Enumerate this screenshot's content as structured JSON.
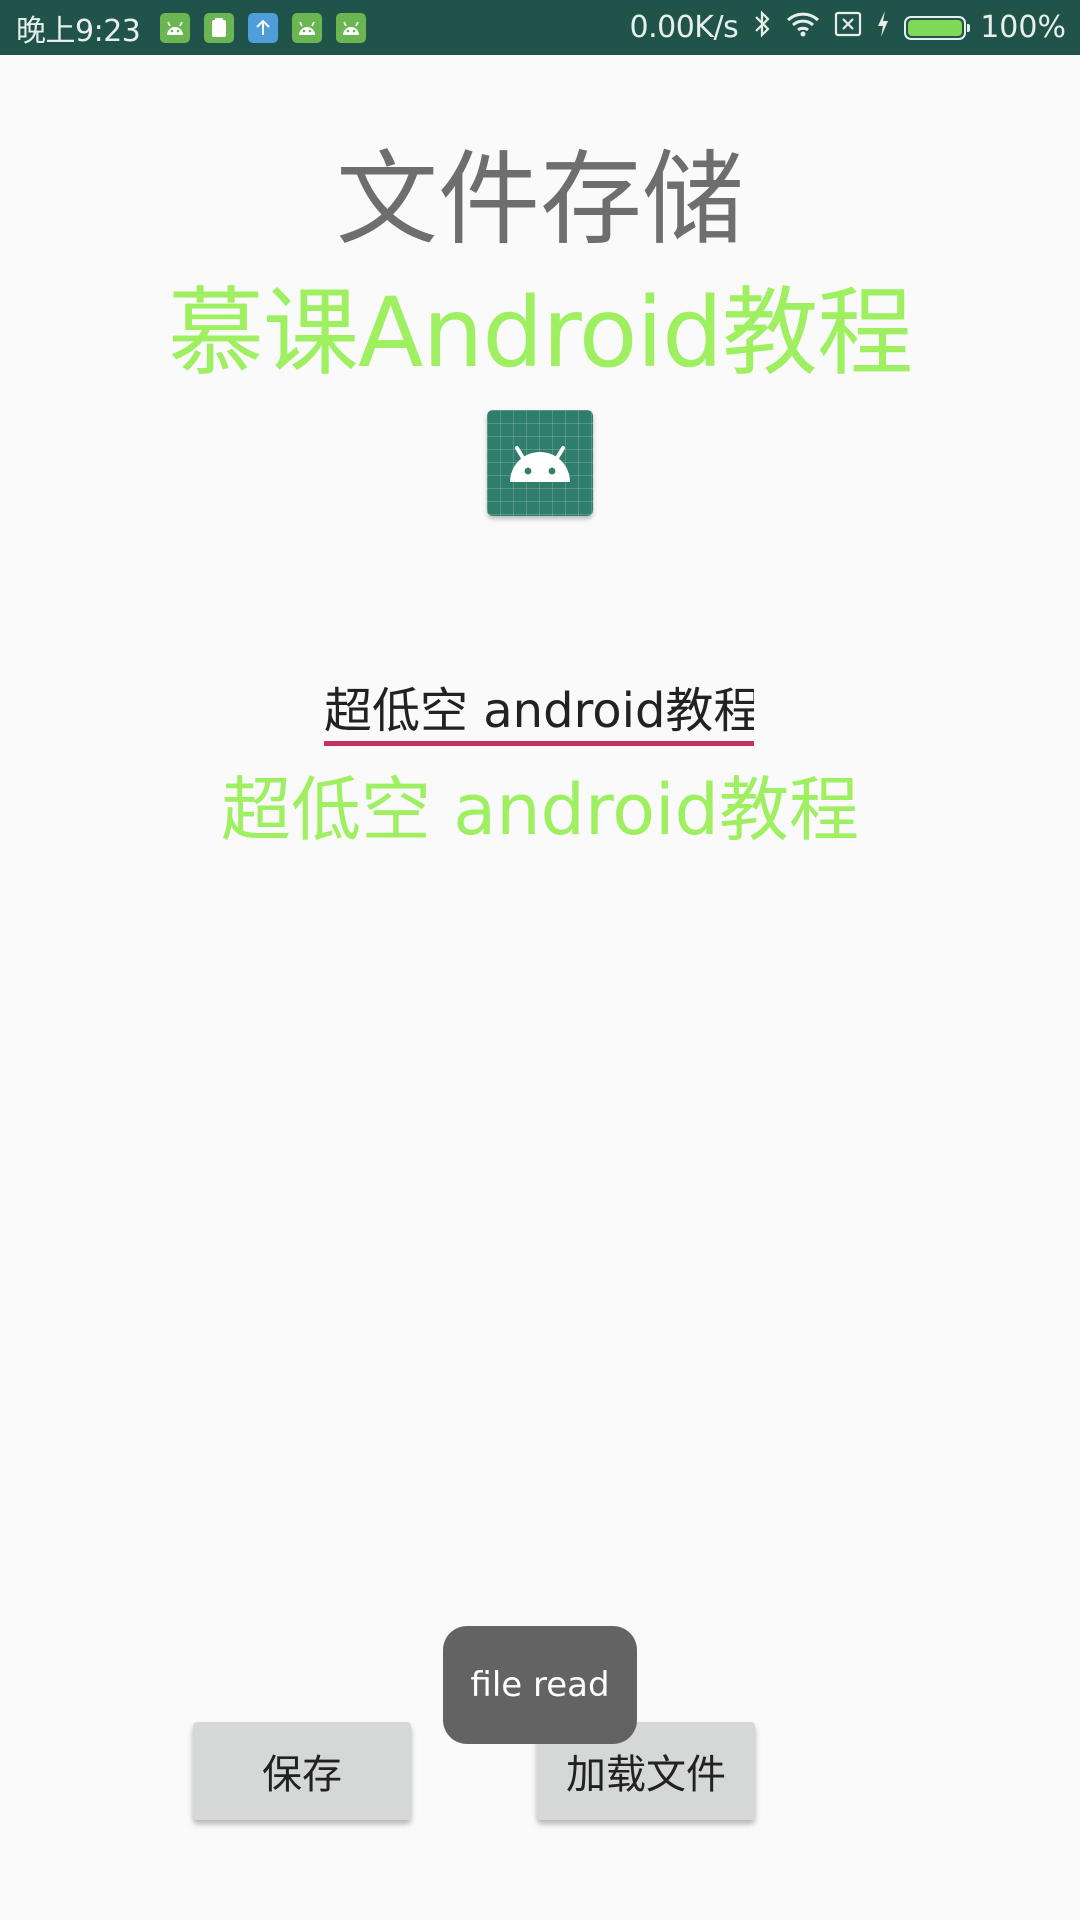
{
  "status_bar": {
    "time": "晚上9:23",
    "notification_icons": [
      "android-icon",
      "clipboard-icon",
      "upload-icon",
      "android-icon",
      "android-icon"
    ],
    "network_speed": "0.00K/s",
    "battery_percent": "100%",
    "battery_level": 1.0,
    "background_color": "#20544a"
  },
  "content": {
    "title": "文件存储",
    "subtitle": "慕课Android教程",
    "image_icon": "android-icon",
    "input_value": "超低空 android教程",
    "result_text": "超低空 android教程",
    "accent_green": "#9ef060",
    "underline_color": "#c2345f"
  },
  "buttons": {
    "save_label": "保存",
    "load_label": "加载文件"
  },
  "toast": {
    "message": "file read"
  }
}
